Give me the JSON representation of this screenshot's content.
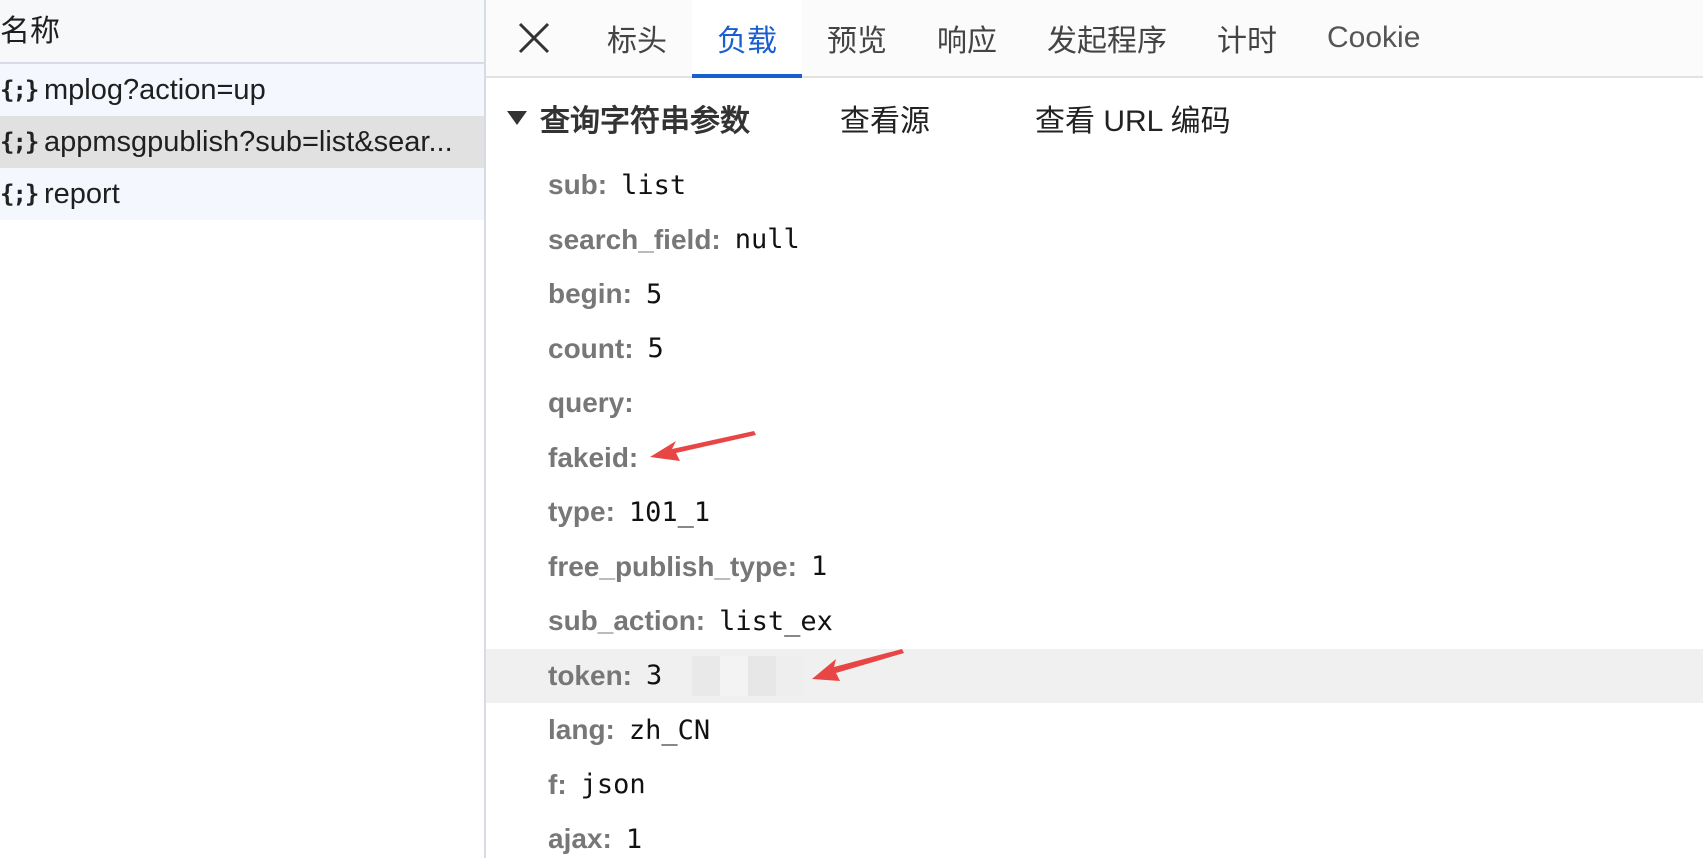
{
  "left": {
    "header": "名称",
    "requests": [
      {
        "icon": "{;}",
        "name": "mplog?action=up",
        "selected": false
      },
      {
        "icon": "{;}",
        "name": "appmsgpublish?sub=list&sear...",
        "selected": true
      },
      {
        "icon": "{;}",
        "name": "report",
        "selected": false
      }
    ]
  },
  "tabs": [
    {
      "label": "标头",
      "active": false
    },
    {
      "label": "负载",
      "active": true
    },
    {
      "label": "预览",
      "active": false
    },
    {
      "label": "响应",
      "active": false
    },
    {
      "label": "发起程序",
      "active": false
    },
    {
      "label": "计时",
      "active": false
    },
    {
      "label": "Cookie",
      "active": false
    }
  ],
  "section": {
    "title": "查询字符串参数",
    "view_source": "查看源",
    "view_url_encoded": "查看 URL 编码"
  },
  "params": [
    {
      "key": "sub:",
      "value": "list"
    },
    {
      "key": "search_field:",
      "value": "null"
    },
    {
      "key": "begin:",
      "value": "5"
    },
    {
      "key": "count:",
      "value": "5"
    },
    {
      "key": "query:",
      "value": ""
    },
    {
      "key": "fakeid:",
      "value": ""
    },
    {
      "key": "type:",
      "value": "101_1"
    },
    {
      "key": "free_publish_type:",
      "value": "1"
    },
    {
      "key": "sub_action:",
      "value": "list_ex"
    },
    {
      "key": "token:",
      "value": "3"
    },
    {
      "key": "lang:",
      "value": "zh_CN"
    },
    {
      "key": "f:",
      "value": "json"
    },
    {
      "key": "ajax:",
      "value": "1"
    }
  ],
  "colors": {
    "accent": "#1a5fd0",
    "annotation_arrow": "#e84545"
  }
}
